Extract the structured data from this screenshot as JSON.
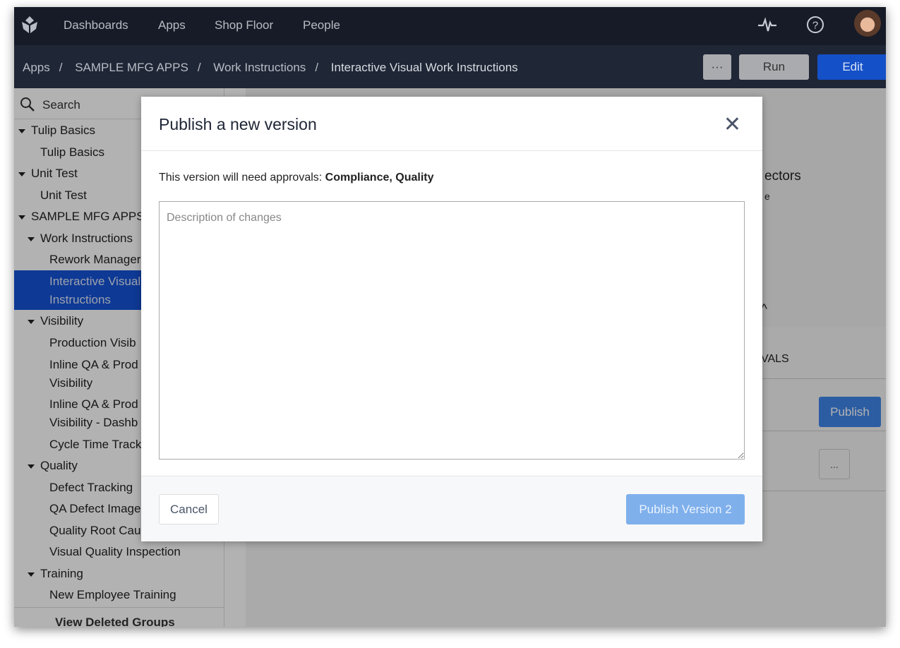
{
  "topnav": {
    "items": [
      "Dashboards",
      "Apps",
      "Shop Floor",
      "People"
    ]
  },
  "breadcrumb": [
    "Apps",
    "SAMPLE MFG APPS",
    "Work Instructions",
    "Interactive Visual Work Instructions"
  ],
  "header_buttons": {
    "more": "···",
    "run": "Run",
    "edit": "Edit"
  },
  "colors": {
    "nav_bg": "#161b27",
    "crumb_bg": "#1f2636",
    "accent": "#1552d6",
    "publish_disabled": "#7fb0ec"
  },
  "sidebar": {
    "search_placeholder": "Search",
    "items": [
      {
        "label": "Tulip Basics"
      },
      {
        "label": "Tulip Basics"
      },
      {
        "label": "Unit Test"
      },
      {
        "label": "Unit Test"
      },
      {
        "label": "SAMPLE MFG APPS"
      },
      {
        "label": "Work Instructions"
      },
      {
        "label": "Rework Manager"
      },
      {
        "label": "Interactive Visual",
        "label2": "Instructions"
      },
      {
        "label": "Visibility"
      },
      {
        "label": "Production Visib"
      },
      {
        "label": "Inline QA & Prod",
        "label2": "Visibility"
      },
      {
        "label": "Inline QA & Prod",
        "label2": "Visibility - Dashb"
      },
      {
        "label": "Cycle Time Track"
      },
      {
        "label": "Quality"
      },
      {
        "label": "Defect Tracking"
      },
      {
        "label": "QA Defect Image"
      },
      {
        "label": "Quality Root Cau"
      },
      {
        "label": "Visual Quality Inspection"
      },
      {
        "label": "Training"
      },
      {
        "label": "New Employee Training"
      }
    ],
    "footer": "View Deleted Groups"
  },
  "main": {
    "connectors_fragment": "ectors",
    "e_fragment": "e",
    "approvals_fragment": "VALS",
    "publish": "Publish",
    "more": "..."
  },
  "modal": {
    "title": "Publish a new version",
    "approval_prefix": "This version will need approvals: ",
    "approvals": "Compliance, Quality",
    "description_placeholder": "Description of changes",
    "description_value": "",
    "cancel": "Cancel",
    "publish": "Publish Version 2"
  }
}
